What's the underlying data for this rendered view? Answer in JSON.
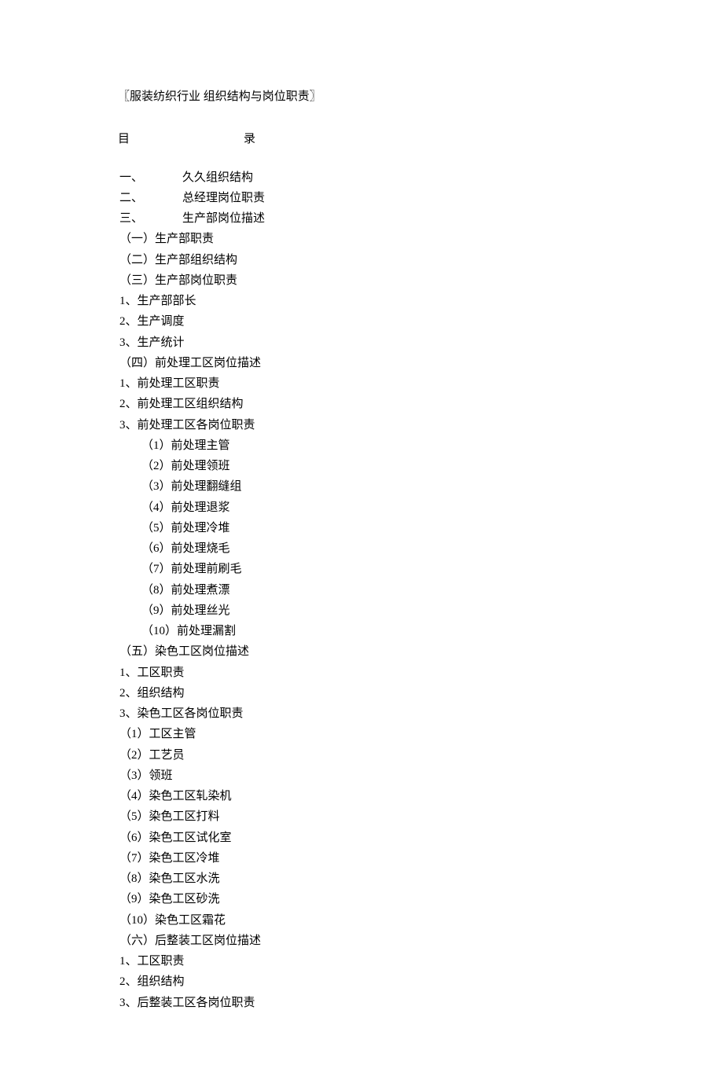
{
  "title": "〖服装纺织行业 组织结构与岗位职责〗",
  "toc_mu": "目",
  "toc_lu": "录",
  "items": [
    {
      "cls": "indent-1",
      "num": "一、",
      "text": "久久组织结构",
      "numcol": true
    },
    {
      "cls": "indent-1",
      "num": "二、",
      "text": "总经理岗位职责",
      "numcol": true
    },
    {
      "cls": "indent-1",
      "num": "三、",
      "text": "生产部岗位描述",
      "numcol": true
    },
    {
      "cls": "indent-1",
      "text": "（一）生产部职责"
    },
    {
      "cls": "indent-1",
      "text": "（二）生产部组织结构"
    },
    {
      "cls": "indent-1",
      "text": "（三）生产部岗位职责"
    },
    {
      "cls": "indent-1",
      "text": "1、生产部部长"
    },
    {
      "cls": "indent-1",
      "text": "2、生产调度"
    },
    {
      "cls": "indent-1",
      "text": "3、生产统计"
    },
    {
      "cls": "indent-1",
      "text": "（四）前处理工区岗位描述"
    },
    {
      "cls": "indent-1",
      "text": "1、前处理工区职责"
    },
    {
      "cls": "indent-1",
      "text": "2、前处理工区组织结构"
    },
    {
      "cls": "indent-1",
      "text": "3、前处理工区各岗位职责"
    },
    {
      "cls": "indent-2",
      "text": "（1）前处理主管"
    },
    {
      "cls": "indent-2",
      "text": "（2）前处理领班"
    },
    {
      "cls": "indent-2",
      "text": "（3）前处理翻缝组"
    },
    {
      "cls": "indent-2",
      "text": "（4）前处理退浆"
    },
    {
      "cls": "indent-2",
      "text": "（5）前处理冷堆"
    },
    {
      "cls": "indent-2",
      "text": "（6）前处理烧毛"
    },
    {
      "cls": "indent-2",
      "text": "（7）前处理前刷毛"
    },
    {
      "cls": "indent-2",
      "text": "（8）前处理煮漂"
    },
    {
      "cls": "indent-2",
      "text": "（9）前处理丝光"
    },
    {
      "cls": "indent-2",
      "text": "（10）前处理漏割"
    },
    {
      "cls": "indent-1",
      "text": "（五）染色工区岗位描述"
    },
    {
      "cls": "indent-1",
      "text": "1、工区职责"
    },
    {
      "cls": "indent-1",
      "text": "2、组织结构"
    },
    {
      "cls": "indent-1",
      "text": "3、染色工区各岗位职责"
    },
    {
      "cls": "indent-3",
      "text": "（1）工区主管"
    },
    {
      "cls": "indent-3",
      "text": "（2）工艺员"
    },
    {
      "cls": "indent-3",
      "text": "（3）领班"
    },
    {
      "cls": "indent-3",
      "text": "（4）染色工区轧染机"
    },
    {
      "cls": "indent-3",
      "text": "（5）染色工区打料"
    },
    {
      "cls": "indent-3",
      "text": "（6）染色工区试化室"
    },
    {
      "cls": "indent-3",
      "text": "（7）染色工区冷堆"
    },
    {
      "cls": "indent-3",
      "text": "（8）染色工区水洗"
    },
    {
      "cls": "indent-3",
      "text": "（9）染色工区砂洗"
    },
    {
      "cls": "indent-3",
      "text": "（10）染色工区霜花"
    },
    {
      "cls": "indent-3",
      "text": "（六）后整装工区岗位描述"
    },
    {
      "cls": "indent-1",
      "text": "1、工区职责"
    },
    {
      "cls": "indent-1",
      "text": "2、组织结构"
    },
    {
      "cls": "indent-1",
      "text": "3、后整装工区各岗位职责"
    }
  ]
}
